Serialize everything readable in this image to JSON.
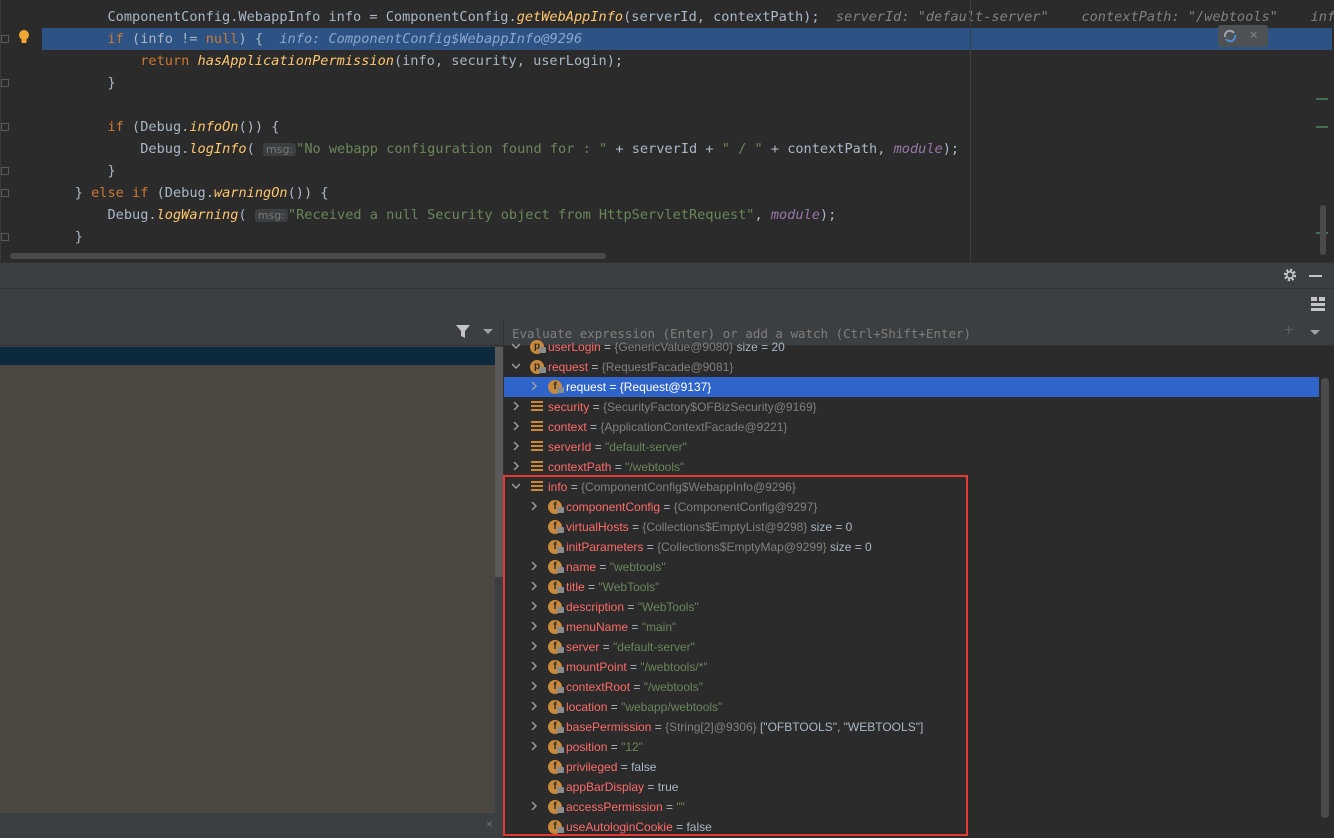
{
  "editor": {
    "line1": {
      "pre": "        ComponentConfig.WebappInfo info = ComponentConfig.",
      "method": "getWebAppInfo",
      "post": "(serverId, contextPath);",
      "inline1": "serverId: \"default-server\"",
      "inline2": "contextPath: \"/webtools\"",
      "inline3": "info:"
    },
    "line2": {
      "pre": "        ",
      "kw_if": "if",
      "mid": " (info != ",
      "kw_null": "null",
      "post": ") {",
      "inline": "info: ComponentConfig$WebappInfo@9296"
    },
    "line3": {
      "pre": "            ",
      "kw_return": "return",
      "sp": " ",
      "method": "hasApplicationPermission",
      "post": "(info, security, userLogin);"
    },
    "line4": "        }",
    "line5": {
      "pre": "        ",
      "kw_if": "if",
      "mid": " (Debug.",
      "method": "infoOn",
      "post": "()) {"
    },
    "line6": {
      "pre": "            Debug.",
      "method": "logInfo",
      "open": "( ",
      "hint": "msg:",
      "str": "\"No webapp configuration found for : \"",
      "mid": " + serverId + ",
      "str2": "\" / \"",
      "mid2": " + contextPath, ",
      "field": "module",
      "post": ");"
    },
    "line7": "        }",
    "line8": {
      "pre": "    } ",
      "kw_else": "else",
      "sp": " ",
      "kw_if": "if",
      "mid": " (Debug.",
      "method": "warningOn",
      "post": "()) {"
    },
    "line9": {
      "pre": "        Debug.",
      "method": "logWarning",
      "open": "( ",
      "hint": "msg:",
      "str": "\"Received a null Security object from HttpServletRequest\"",
      "mid": ", ",
      "field": "module",
      "post": ");"
    },
    "line10": "    }"
  },
  "watch": {
    "placeholder": "Evaluate expression (Enter) or add a watch (Ctrl+Shift+Enter)",
    "add_label": "+"
  },
  "frames": {
    "close_label": "×"
  },
  "float_close": "×",
  "variables": [
    {
      "name": "userLogin",
      "eq": " = ",
      "type": "{GenericValue@9080}",
      "extra": " size = 20",
      "icon": "p",
      "state": "expanded"
    },
    {
      "name": "request",
      "eq": " = ",
      "type": "{RequestFacade@9081}",
      "extra": "",
      "icon": "p",
      "state": "expanded"
    },
    {
      "name": "request",
      "eq": " = ",
      "type": "{Request@9137}",
      "extra": "",
      "icon": "f",
      "state": "collapsed"
    },
    {
      "name": "security",
      "eq": " = ",
      "type": "{SecurityFactory$OFBizSecurity@9169}",
      "extra": "",
      "icon": "var",
      "state": "collapsed"
    },
    {
      "name": "context",
      "eq": " = ",
      "type": "{ApplicationContextFacade@9221}",
      "extra": "",
      "icon": "var",
      "state": "collapsed"
    },
    {
      "name": "serverId",
      "eq": " = ",
      "value": "\"default-server\"",
      "icon": "var",
      "state": "collapsed"
    },
    {
      "name": "contextPath",
      "eq": " = ",
      "value": "\"/webtools\"",
      "icon": "var",
      "state": "collapsed"
    },
    {
      "name": "info",
      "eq": " = ",
      "type": "{ComponentConfig$WebappInfo@9296}",
      "extra": "",
      "icon": "var",
      "state": "expanded"
    },
    {
      "name": "componentConfig",
      "eq": " = ",
      "type": "{ComponentConfig@9297}",
      "extra": "",
      "icon": "f",
      "state": "collapsed"
    },
    {
      "name": "virtualHosts",
      "eq": " = ",
      "type": "{Collections$EmptyList@9298}",
      "extra": " size = 0",
      "icon": "f",
      "state": "none"
    },
    {
      "name": "initParameters",
      "eq": " = ",
      "type": "{Collections$EmptyMap@9299}",
      "extra": " size = 0",
      "icon": "f",
      "state": "none"
    },
    {
      "name": "name",
      "eq": " = ",
      "value": "\"webtools\"",
      "icon": "f",
      "state": "collapsed"
    },
    {
      "name": "title",
      "eq": " = ",
      "value": "\"WebTools\"",
      "icon": "f",
      "state": "collapsed"
    },
    {
      "name": "description",
      "eq": " = ",
      "value": "\"WebTools\"",
      "icon": "f",
      "state": "collapsed"
    },
    {
      "name": "menuName",
      "eq": " = ",
      "value": "\"main\"",
      "icon": "f",
      "state": "collapsed"
    },
    {
      "name": "server",
      "eq": " = ",
      "value": "\"default-server\"",
      "icon": "f",
      "state": "collapsed"
    },
    {
      "name": "mountPoint",
      "eq": " = ",
      "value": "\"/webtools/*\"",
      "icon": "f",
      "state": "collapsed"
    },
    {
      "name": "contextRoot",
      "eq": " = ",
      "value": "\"/webtools\"",
      "icon": "f",
      "state": "collapsed"
    },
    {
      "name": "location",
      "eq": " = ",
      "value": "\"webapp/webtools\"",
      "icon": "f",
      "state": "collapsed"
    },
    {
      "name": "basePermission",
      "eq": " = ",
      "type": "{String[2]@9306}",
      "extra": " [\"OFBTOOLS\", \"WEBTOOLS\"]",
      "icon": "f",
      "state": "collapsed"
    },
    {
      "name": "position",
      "eq": " = ",
      "value": "\"12\"",
      "icon": "f",
      "state": "collapsed"
    },
    {
      "name": "privileged",
      "eq": " = ",
      "plain": "false",
      "icon": "f",
      "state": "none"
    },
    {
      "name": "appBarDisplay",
      "eq": " = ",
      "plain": "true",
      "icon": "f",
      "state": "none"
    },
    {
      "name": "accessPermission",
      "eq": " = ",
      "value": "\"\"",
      "icon": "f",
      "state": "collapsed"
    },
    {
      "name": "useAutologinCookie",
      "eq": " = ",
      "plain": "false",
      "icon": "f",
      "state": "none"
    }
  ],
  "colors": {
    "highlight": "#2d5284",
    "selection": "#2f65ca",
    "annotation_box": "#e53935"
  }
}
